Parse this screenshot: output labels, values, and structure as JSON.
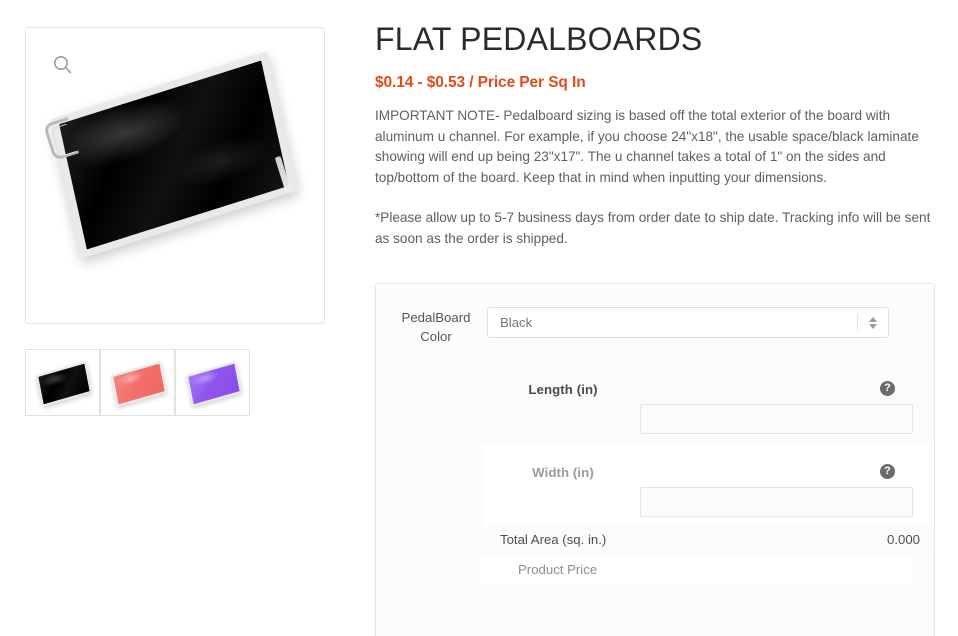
{
  "product": {
    "title": "FLAT PEDALBOARDS",
    "price_range": "$0.14 - $0.53 / Price Per Sq In",
    "price_color": "#e24a1a",
    "description_1": "IMPORTANT NOTE-\nPedalboard sizing is based off the total exterior of the board with aluminum u channel. For example, if you choose 24\"x18\", the usable space/black laminate showing will end up being 23\"x17\". The u channel takes a total of 1\" on the sides and top/bottom of the board. Keep that in mind when inputting your dimensions.",
    "description_2": "*Please allow up to 5-7 business days from order date to ship date. Tracking info will be sent as soon as the order is shipped."
  },
  "gallery": {
    "zoom_icon": "search-icon",
    "main_image_alt": "Black flat pedalboard with aluminum u channel and handle",
    "thumbnails": [
      {
        "color_name": "Black",
        "swatch": "#0d0d0d",
        "selected": true
      },
      {
        "color_name": "Coral",
        "swatch": "#f2706c",
        "selected": false
      },
      {
        "color_name": "Purple",
        "swatch": "#9055ee",
        "selected": false
      }
    ]
  },
  "form": {
    "color_field": {
      "label": "PedalBoard Color",
      "label_line_1": "PedalBoard",
      "label_line_2": "Color",
      "value": "Black",
      "options": [
        "Black"
      ]
    },
    "length_field": {
      "label": "Length (in)",
      "value": "",
      "placeholder": "",
      "help_icon": "question-mark-icon"
    },
    "width_field": {
      "label": "Width (in)",
      "value": "",
      "placeholder": "",
      "help_icon": "question-mark-icon"
    },
    "total_area": {
      "label": "Total Area (sq. in.)",
      "value": "0.000"
    },
    "product_price": {
      "label": "Product Price",
      "value": ""
    }
  }
}
